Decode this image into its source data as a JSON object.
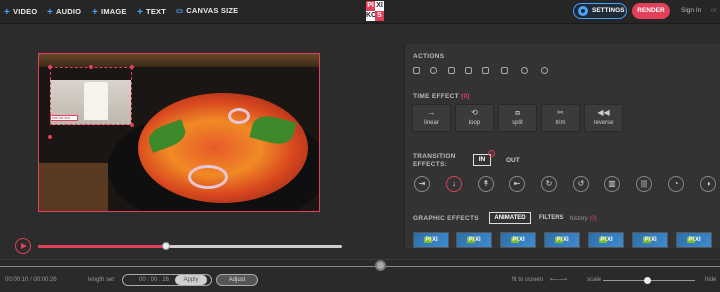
{
  "toolbar": {
    "video": "VIDEO",
    "audio": "AUDIO",
    "image": "IMAGE",
    "text": "TEXT",
    "canvas_size": "CANVAS SIZE",
    "logo_letters": [
      "PI",
      "XI",
      "KO",
      "S"
    ],
    "settings": "SETTINGS",
    "render": "RENDER",
    "sign_in": "Sign In",
    "more": "or"
  },
  "overlay": {
    "tag_text": "edit the text"
  },
  "player": {
    "progress": 0.42
  },
  "panel": {
    "actions_title": "ACTIONS",
    "action_icons": [
      "trash-icon",
      "copy-icon",
      "flip-icon",
      "volume-icon",
      "mute-icon",
      "crop-icon",
      "contrast-icon",
      "brightness-icon"
    ],
    "time_effect_title": "TIME EFFECT",
    "time_effect_count": "(0)",
    "time_effects": [
      {
        "label": "linear",
        "glyph": "→"
      },
      {
        "label": "loop",
        "glyph": "⟲"
      },
      {
        "label": "split",
        "glyph": "⧈"
      },
      {
        "label": "trim",
        "glyph": "✂"
      },
      {
        "label": "reverse",
        "glyph": "◀◀"
      }
    ],
    "transition_title_1": "TRANSITION",
    "transition_title_2": "EFFECTS:",
    "transition_in": "IN",
    "transition_in_badge": "1",
    "transition_out": "OUT",
    "transition_icons": [
      "⇥",
      "↓",
      "↟",
      "⇤",
      "↻",
      "↺",
      "▥",
      "|||",
      "◔",
      "◑"
    ],
    "graphic_effects_title": "GRAPHIC EFFECTS",
    "animated": "ANIMATED",
    "filters": "FILTERS",
    "history": "history",
    "history_count": "(0)",
    "thumbnails": 7
  },
  "bottom": {
    "time": "00:00:10 / 00:00:26",
    "length_label": "length set",
    "length_value": "00 : 00 : 26",
    "apply": "Apply",
    "adjust": "Adjust",
    "fit_to_screen": "fit to screen",
    "scale": "scale",
    "hide": "hide"
  },
  "colors": {
    "accent_red": "#e0405a",
    "accent_blue": "#4aa3ff"
  }
}
